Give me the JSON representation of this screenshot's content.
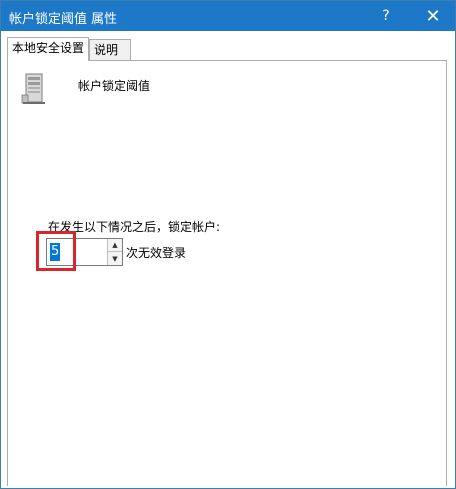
{
  "window": {
    "title": "帐户锁定阈值 属性",
    "help_glyph": "?",
    "close_glyph": "✕"
  },
  "tabs": [
    {
      "label": "本地安全设置",
      "active": true
    },
    {
      "label": "说明",
      "active": false
    }
  ],
  "policy": {
    "icon": "server-icon",
    "name": "帐户锁定阈值"
  },
  "setting": {
    "prompt": "在发生以下情况之后，锁定帐户:",
    "value": "5",
    "unit": "次无效登录"
  },
  "colors": {
    "titlebar": "#1e78c8",
    "selection": "#0078d7",
    "highlight_box": "#d9262b"
  }
}
